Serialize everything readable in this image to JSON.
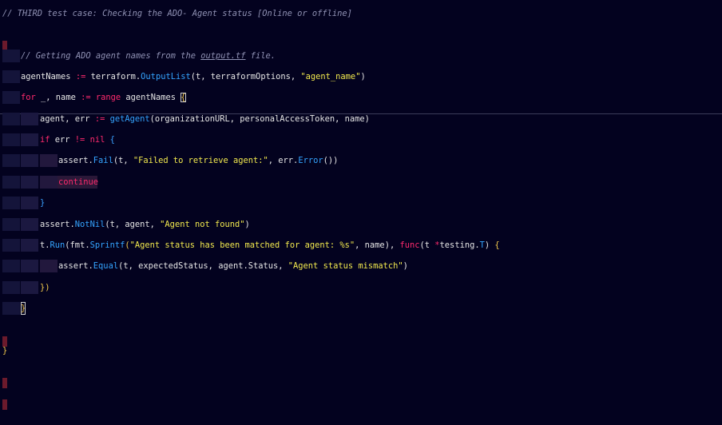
{
  "editor": {
    "lines": {
      "l1": "// THIRD test case: Checking the ADO- Agent status [Online or offline]",
      "l3_a": "// Getting ADO agent names from the ",
      "l3_b": "output.tf",
      "l3_c": " file.",
      "l4_a": "agentNames ",
      "l4_op": ":=",
      "l4_b": " terraform.",
      "l4_fn": "OutputList",
      "l4_c": "(t, terraformOptions, ",
      "l4_str": "\"agent_name\"",
      "l4_d": ")",
      "l5_kw": "for",
      "l5_a": " _, name ",
      "l5_op": ":=",
      "l5_kw2": " range",
      "l5_b": " agentNames ",
      "l5_br": "{",
      "l6_a": "agent, err ",
      "l6_op": ":=",
      "l6_fn": " getAgent",
      "l6_b": "(organizationURL, personalAccessToken, name)",
      "l7_kw": "if",
      "l7_a": " err ",
      "l7_op": "!=",
      "l7_kw2": " nil",
      "l7_br": " {",
      "l8_a": "assert.",
      "l8_fn": "Fail",
      "l8_b": "(t, ",
      "l8_str": "\"Failed to retrieve agent:\"",
      "l8_c": ", err.",
      "l8_fn2": "Error",
      "l8_d": "())",
      "l9_kw": "continue",
      "l10_br": "}",
      "l11_a": "assert.",
      "l11_fn": "NotNil",
      "l11_b": "(t, agent, ",
      "l11_str": "\"Agent not found\"",
      "l11_c": ")",
      "l12_a": "t.",
      "l12_fn": "Run",
      "l12_b": "(fmt.",
      "l12_fn2": "Sprintf",
      "l12_c": "(",
      "l12_str": "\"Agent status has been matched for agent: %s\"",
      "l12_d": ", name), ",
      "l12_kw": "func",
      "l12_e": "(t ",
      "l12_op": "*",
      "l12_f": "testing.",
      "l12_g": "T",
      "l12_h": ") ",
      "l12_br": "{",
      "l13_a": "assert.",
      "l13_fn": "Equal",
      "l13_b": "(t, expectedStatus, agent.Status, ",
      "l13_str": "\"Agent status mismatch\"",
      "l13_c": ")",
      "l14_br": "})",
      "l15_br": "}",
      "l17_br": "}"
    }
  },
  "colors": {
    "background": "#03021f",
    "keyword": "#ff2a6d",
    "function": "#34a4ff",
    "string": "#f2e94e",
    "comment": "#8f91b3",
    "bracket": "#f2c94c"
  }
}
